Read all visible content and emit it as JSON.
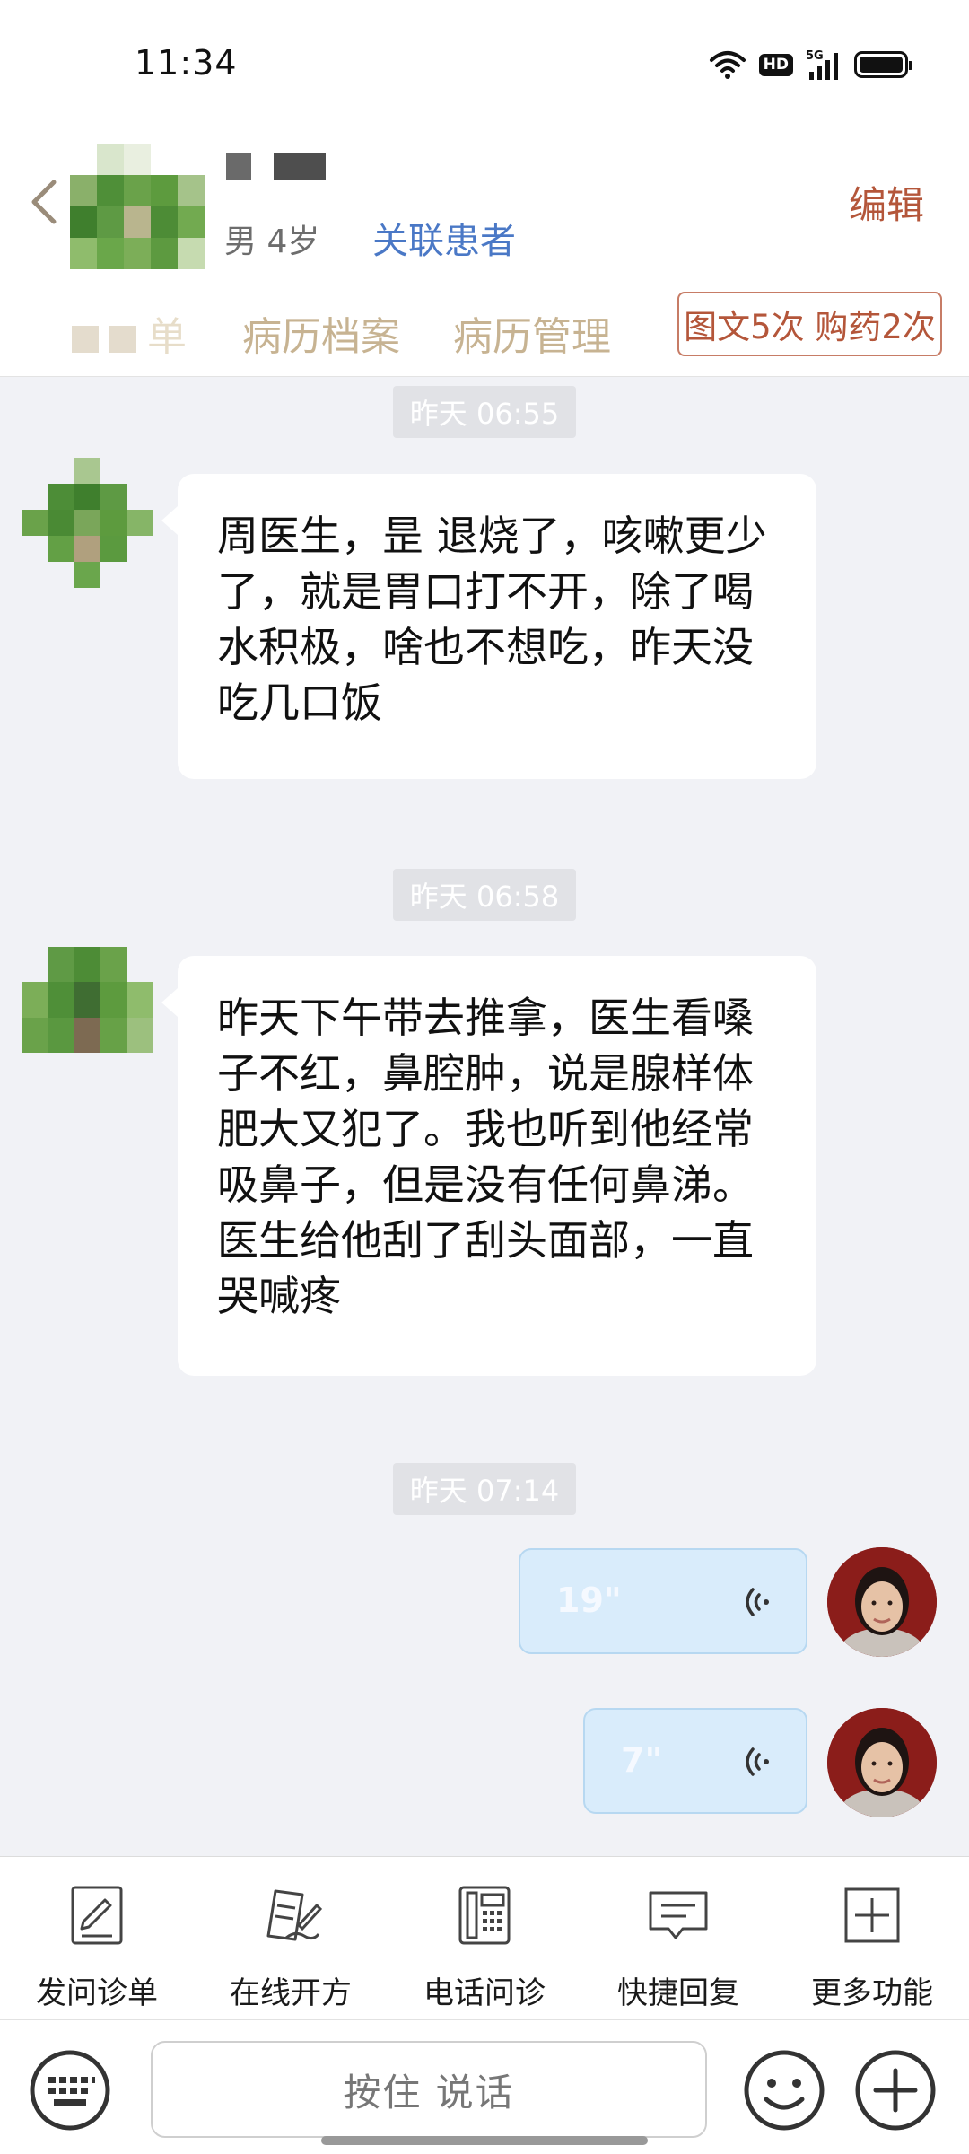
{
  "status_bar": {
    "time": "11:34",
    "hd": "HD",
    "network": "5G"
  },
  "header": {
    "gender_age": "男 4岁",
    "link_patient": "关联患者",
    "edit": "编辑",
    "tabs": [
      {
        "label": "单"
      },
      {
        "label": "病历档案"
      },
      {
        "label": "病历管理"
      }
    ],
    "usage_badge": "图文5次 购药2次"
  },
  "chat": {
    "messages": [
      {
        "timestamp": "昨天 06:55",
        "text": "周医生，昰 退烧了，咳嗽更少了，就是胃口打不开，除了喝水积极，啥也不想吃，昨天没吃几口饭"
      },
      {
        "timestamp": "昨天 06:58",
        "text": "昨天下午带去推拿，医生看嗓子不红，鼻腔肿，说是腺样体肥大又犯了。我也听到他经常吸鼻子，但是没有任何鼻涕。医生给他刮了刮头面部，一直哭喊疼"
      },
      {
        "timestamp": "昨天 07:14"
      }
    ],
    "voice_messages": [
      {
        "duration": "19\""
      },
      {
        "duration": "7\""
      }
    ]
  },
  "toolbar": {
    "items": [
      {
        "label": "发问诊单",
        "icon": "form-icon"
      },
      {
        "label": "在线开方",
        "icon": "prescription-icon"
      },
      {
        "label": "电话问诊",
        "icon": "phone-icon"
      },
      {
        "label": "快捷回复",
        "icon": "quick-reply-icon"
      },
      {
        "label": "更多功能",
        "icon": "more-icon"
      }
    ]
  },
  "input_bar": {
    "voice_button": "按住 说话"
  },
  "colors": {
    "accent_blue": "#4a78c6",
    "accent_brown": "#b4563a",
    "tab_tan": "#c7b392",
    "voice_bubble": "#d9ecfb",
    "chat_bg": "#f1f2f6"
  }
}
